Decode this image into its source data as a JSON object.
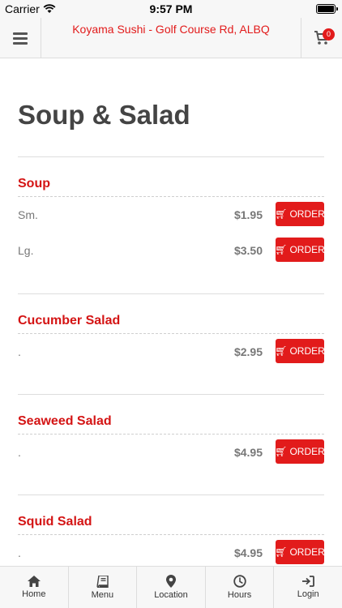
{
  "status": {
    "carrier": "Carrier",
    "time": "9:57 PM"
  },
  "header": {
    "title": "Koyama Sushi - Golf Course Rd, ALBQ",
    "cart_count": "0"
  },
  "page": {
    "title": "Soup & Salad"
  },
  "sections": [
    {
      "name": "Soup",
      "items": [
        {
          "label": "Sm.",
          "price": "$1.95",
          "button": "ORDER"
        },
        {
          "label": "Lg.",
          "price": "$3.50",
          "button": "ORDER"
        }
      ]
    },
    {
      "name": "Cucumber Salad",
      "items": [
        {
          "label": ".",
          "price": "$2.95",
          "button": "ORDER"
        }
      ]
    },
    {
      "name": "Seaweed Salad",
      "items": [
        {
          "label": ".",
          "price": "$4.95",
          "button": "ORDER"
        }
      ]
    },
    {
      "name": "Squid Salad",
      "items": [
        {
          "label": ".",
          "price": "$4.95",
          "button": "ORDER"
        }
      ]
    }
  ],
  "nav": [
    {
      "label": "Home",
      "icon": "home-icon"
    },
    {
      "label": "Menu",
      "icon": "book-icon"
    },
    {
      "label": "Location",
      "icon": "map-pin-icon"
    },
    {
      "label": "Hours",
      "icon": "clock-icon"
    },
    {
      "label": "Login",
      "icon": "login-icon"
    }
  ],
  "colors": {
    "accent": "#e21b1b",
    "section_title": "#d41414"
  }
}
